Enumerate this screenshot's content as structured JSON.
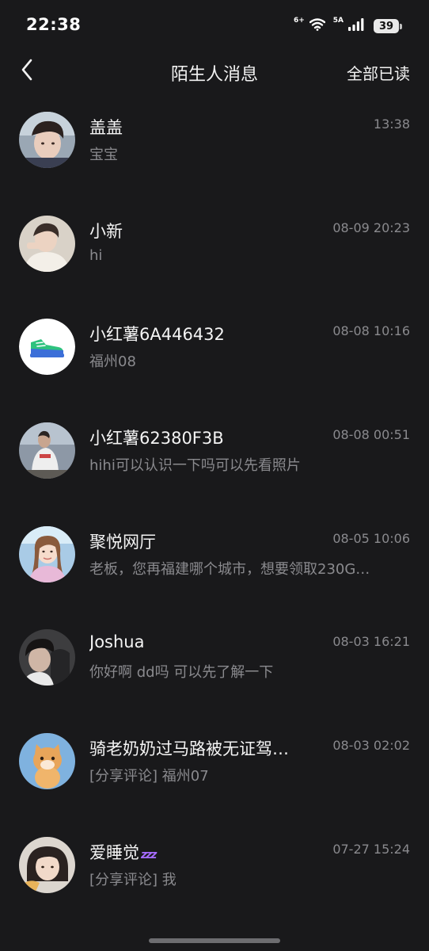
{
  "status_bar": {
    "time": "22:38",
    "wifi_label": "6+",
    "signal_label": "5A",
    "battery_level": "39"
  },
  "nav": {
    "title": "陌生人消息",
    "mark_all_read": "全部已读",
    "back_icon": "chevron-left-icon"
  },
  "messages": [
    {
      "name": "盖盖",
      "time": "13:38",
      "preview": "宝宝",
      "avatar": "photo-boy-selfie"
    },
    {
      "name": "小新",
      "time": "08-09 20:23",
      "preview": "hi",
      "avatar": "photo-boy-white-shirt"
    },
    {
      "name": "小红薯6A446432",
      "time": "08-08 10:16",
      "preview": "福州08",
      "avatar": "sneaker-icon"
    },
    {
      "name": "小红薯62380F3B",
      "time": "08-08 00:51",
      "preview": "hihi可以认识一下吗可以先看照片",
      "avatar": "photo-man-outdoor"
    },
    {
      "name": "聚悦网厅",
      "time": "08-05 10:06",
      "preview": "老板，您再福建哪个城市，想要领取230G…",
      "avatar": "photo-girl-smiling"
    },
    {
      "name": "Joshua",
      "time": "08-03 16:21",
      "preview": "你好啊 dd吗 可以先了解一下",
      "avatar": "photo-boy-dark"
    },
    {
      "name": "骑老奶奶过马路被无证驾…",
      "time": "08-03 02:02",
      "preview": "[分享评论] 福州07",
      "avatar": "photo-orange-cat"
    },
    {
      "name": "爱睡觉",
      "name_suffix": "zzz",
      "time": "07-27 15:24",
      "preview": "[分享评论] 我",
      "avatar": "photo-girl-portrait"
    }
  ],
  "colors": {
    "background": "#19191b",
    "primary_text": "#f4f4f4",
    "secondary_text": "#8a8a8e",
    "zzz_accent": "#a66cff",
    "sneaker_green": "#2ec27e",
    "sneaker_blue": "#3c6fd8"
  }
}
